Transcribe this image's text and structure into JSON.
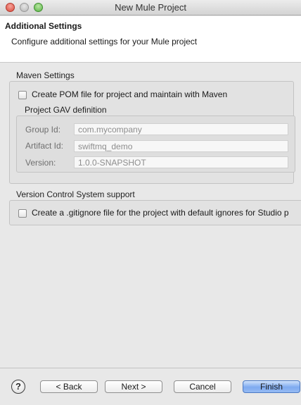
{
  "window": {
    "title": "New Mule Project"
  },
  "header": {
    "title": "Additional Settings",
    "description": "Configure additional settings for your Mule project"
  },
  "maven": {
    "section_label": "Maven Settings",
    "create_pom_label": "Create POM file for project and maintain with Maven",
    "create_pom_checked": false,
    "gav": {
      "label": "Project GAV definition",
      "group_id_label": "Group Id:",
      "group_id_value": "com.mycompany",
      "artifact_id_label": "Artifact Id:",
      "artifact_id_value": "swiftmq_demo",
      "version_label": "Version:",
      "version_value": "1.0.0-SNAPSHOT"
    }
  },
  "vcs": {
    "section_label": "Version Control System support",
    "gitignore_label": "Create a .gitignore file for the project with default ignores for Studio p",
    "gitignore_checked": false
  },
  "footer": {
    "help_icon": "help-icon",
    "back_label": "< Back",
    "next_label": "Next >",
    "cancel_label": "Cancel",
    "finish_label": "Finish"
  },
  "colors": {
    "primary_button": "#7eaaf0",
    "header_bg": "#ffffff",
    "dialog_bg": "#e8e8e8"
  }
}
